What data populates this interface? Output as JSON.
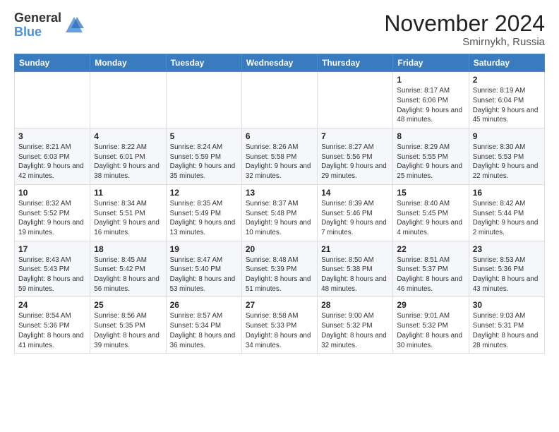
{
  "logo": {
    "general": "General",
    "blue": "Blue"
  },
  "header": {
    "month": "November 2024",
    "location": "Smirnykh, Russia"
  },
  "weekdays": [
    "Sunday",
    "Monday",
    "Tuesday",
    "Wednesday",
    "Thursday",
    "Friday",
    "Saturday"
  ],
  "weeks": [
    [
      {
        "day": "",
        "sunrise": "",
        "sunset": "",
        "daylight": ""
      },
      {
        "day": "",
        "sunrise": "",
        "sunset": "",
        "daylight": ""
      },
      {
        "day": "",
        "sunrise": "",
        "sunset": "",
        "daylight": ""
      },
      {
        "day": "",
        "sunrise": "",
        "sunset": "",
        "daylight": ""
      },
      {
        "day": "",
        "sunrise": "",
        "sunset": "",
        "daylight": ""
      },
      {
        "day": "1",
        "sunrise": "Sunrise: 8:17 AM",
        "sunset": "Sunset: 6:06 PM",
        "daylight": "Daylight: 9 hours and 48 minutes."
      },
      {
        "day": "2",
        "sunrise": "Sunrise: 8:19 AM",
        "sunset": "Sunset: 6:04 PM",
        "daylight": "Daylight: 9 hours and 45 minutes."
      }
    ],
    [
      {
        "day": "3",
        "sunrise": "Sunrise: 8:21 AM",
        "sunset": "Sunset: 6:03 PM",
        "daylight": "Daylight: 9 hours and 42 minutes."
      },
      {
        "day": "4",
        "sunrise": "Sunrise: 8:22 AM",
        "sunset": "Sunset: 6:01 PM",
        "daylight": "Daylight: 9 hours and 38 minutes."
      },
      {
        "day": "5",
        "sunrise": "Sunrise: 8:24 AM",
        "sunset": "Sunset: 5:59 PM",
        "daylight": "Daylight: 9 hours and 35 minutes."
      },
      {
        "day": "6",
        "sunrise": "Sunrise: 8:26 AM",
        "sunset": "Sunset: 5:58 PM",
        "daylight": "Daylight: 9 hours and 32 minutes."
      },
      {
        "day": "7",
        "sunrise": "Sunrise: 8:27 AM",
        "sunset": "Sunset: 5:56 PM",
        "daylight": "Daylight: 9 hours and 29 minutes."
      },
      {
        "day": "8",
        "sunrise": "Sunrise: 8:29 AM",
        "sunset": "Sunset: 5:55 PM",
        "daylight": "Daylight: 9 hours and 25 minutes."
      },
      {
        "day": "9",
        "sunrise": "Sunrise: 8:30 AM",
        "sunset": "Sunset: 5:53 PM",
        "daylight": "Daylight: 9 hours and 22 minutes."
      }
    ],
    [
      {
        "day": "10",
        "sunrise": "Sunrise: 8:32 AM",
        "sunset": "Sunset: 5:52 PM",
        "daylight": "Daylight: 9 hours and 19 minutes."
      },
      {
        "day": "11",
        "sunrise": "Sunrise: 8:34 AM",
        "sunset": "Sunset: 5:51 PM",
        "daylight": "Daylight: 9 hours and 16 minutes."
      },
      {
        "day": "12",
        "sunrise": "Sunrise: 8:35 AM",
        "sunset": "Sunset: 5:49 PM",
        "daylight": "Daylight: 9 hours and 13 minutes."
      },
      {
        "day": "13",
        "sunrise": "Sunrise: 8:37 AM",
        "sunset": "Sunset: 5:48 PM",
        "daylight": "Daylight: 9 hours and 10 minutes."
      },
      {
        "day": "14",
        "sunrise": "Sunrise: 8:39 AM",
        "sunset": "Sunset: 5:46 PM",
        "daylight": "Daylight: 9 hours and 7 minutes."
      },
      {
        "day": "15",
        "sunrise": "Sunrise: 8:40 AM",
        "sunset": "Sunset: 5:45 PM",
        "daylight": "Daylight: 9 hours and 4 minutes."
      },
      {
        "day": "16",
        "sunrise": "Sunrise: 8:42 AM",
        "sunset": "Sunset: 5:44 PM",
        "daylight": "Daylight: 9 hours and 2 minutes."
      }
    ],
    [
      {
        "day": "17",
        "sunrise": "Sunrise: 8:43 AM",
        "sunset": "Sunset: 5:43 PM",
        "daylight": "Daylight: 8 hours and 59 minutes."
      },
      {
        "day": "18",
        "sunrise": "Sunrise: 8:45 AM",
        "sunset": "Sunset: 5:42 PM",
        "daylight": "Daylight: 8 hours and 56 minutes."
      },
      {
        "day": "19",
        "sunrise": "Sunrise: 8:47 AM",
        "sunset": "Sunset: 5:40 PM",
        "daylight": "Daylight: 8 hours and 53 minutes."
      },
      {
        "day": "20",
        "sunrise": "Sunrise: 8:48 AM",
        "sunset": "Sunset: 5:39 PM",
        "daylight": "Daylight: 8 hours and 51 minutes."
      },
      {
        "day": "21",
        "sunrise": "Sunrise: 8:50 AM",
        "sunset": "Sunset: 5:38 PM",
        "daylight": "Daylight: 8 hours and 48 minutes."
      },
      {
        "day": "22",
        "sunrise": "Sunrise: 8:51 AM",
        "sunset": "Sunset: 5:37 PM",
        "daylight": "Daylight: 8 hours and 46 minutes."
      },
      {
        "day": "23",
        "sunrise": "Sunrise: 8:53 AM",
        "sunset": "Sunset: 5:36 PM",
        "daylight": "Daylight: 8 hours and 43 minutes."
      }
    ],
    [
      {
        "day": "24",
        "sunrise": "Sunrise: 8:54 AM",
        "sunset": "Sunset: 5:36 PM",
        "daylight": "Daylight: 8 hours and 41 minutes."
      },
      {
        "day": "25",
        "sunrise": "Sunrise: 8:56 AM",
        "sunset": "Sunset: 5:35 PM",
        "daylight": "Daylight: 8 hours and 39 minutes."
      },
      {
        "day": "26",
        "sunrise": "Sunrise: 8:57 AM",
        "sunset": "Sunset: 5:34 PM",
        "daylight": "Daylight: 8 hours and 36 minutes."
      },
      {
        "day": "27",
        "sunrise": "Sunrise: 8:58 AM",
        "sunset": "Sunset: 5:33 PM",
        "daylight": "Daylight: 8 hours and 34 minutes."
      },
      {
        "day": "28",
        "sunrise": "Sunrise: 9:00 AM",
        "sunset": "Sunset: 5:32 PM",
        "daylight": "Daylight: 8 hours and 32 minutes."
      },
      {
        "day": "29",
        "sunrise": "Sunrise: 9:01 AM",
        "sunset": "Sunset: 5:32 PM",
        "daylight": "Daylight: 8 hours and 30 minutes."
      },
      {
        "day": "30",
        "sunrise": "Sunrise: 9:03 AM",
        "sunset": "Sunset: 5:31 PM",
        "daylight": "Daylight: 8 hours and 28 minutes."
      }
    ]
  ]
}
